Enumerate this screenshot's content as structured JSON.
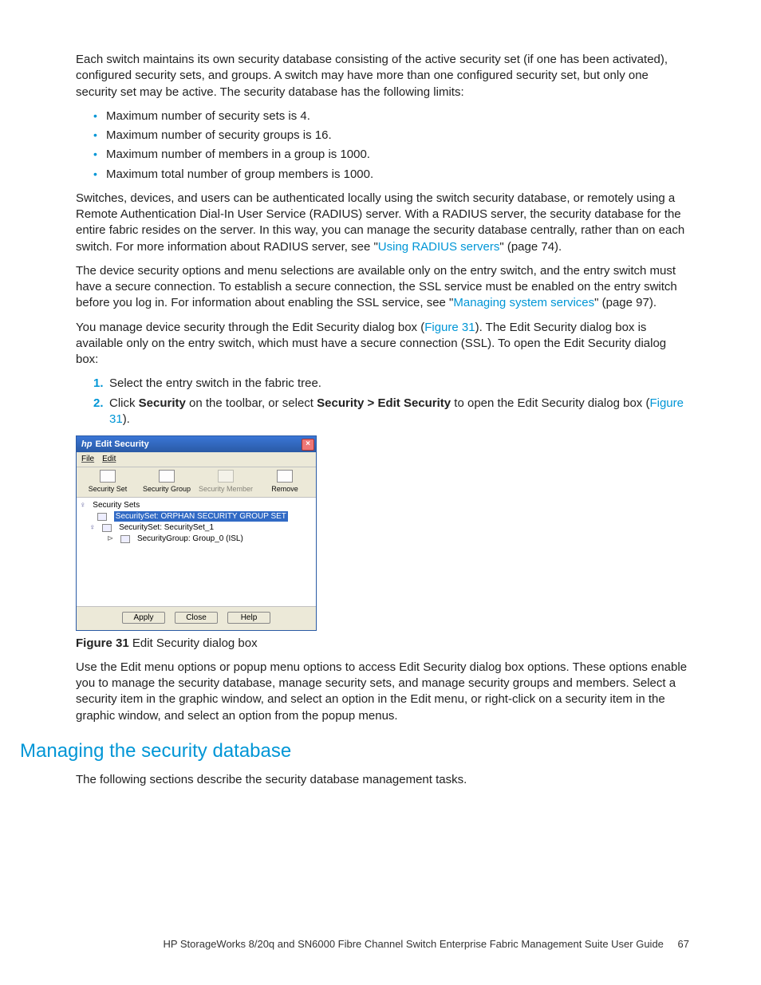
{
  "intro": "Each switch maintains its own security database consisting of the active security set (if one has been activated), configured security sets, and groups. A switch may have more than one configured security set, but only one security set may be active. The security database has the following limits:",
  "limits": [
    "Maximum number of security sets is 4.",
    "Maximum number of security groups is 16.",
    "Maximum number of members in a group is 1000.",
    "Maximum total number of group members is 1000."
  ],
  "p2_a": "Switches, devices, and users can be authenticated locally using the switch security database, or remotely using a Remote Authentication Dial-In User Service (RADIUS) server. With a RADIUS server, the security database for the entire fabric resides on the server. In this way, you can manage the security database centrally, rather than on each switch. For more information about RADIUS server, see \"",
  "p2_link": "Using RADIUS servers",
  "p2_b": "\" (page 74).",
  "p3_a": "The device security options and menu selections are available only on the entry switch, and the entry switch must have a secure connection. To establish a secure connection, the SSL service must be enabled on the entry switch before you log in. For information about enabling the SSL service, see \"",
  "p3_link": "Managing system services",
  "p3_b": "\" (page 97).",
  "p4_a": "You manage device security through the Edit Security dialog box (",
  "p4_link": "Figure 31",
  "p4_b": "). The Edit Security dialog box is available only on the entry switch, which must have a secure connection (SSL). To open the Edit Security dialog box:",
  "ol": [
    "Select the entry switch in the fabric tree."
  ],
  "ol2_a": "Click ",
  "ol2_b1": "Security",
  "ol2_c": " on the toolbar, or select ",
  "ol2_b2": "Security > Edit Security",
  "ol2_d": " to open the Edit Security dialog box (",
  "ol2_link": "Figure 31",
  "ol2_e": ").",
  "dialog": {
    "title": "Edit Security",
    "menu": {
      "file": "File",
      "edit": "Edit"
    },
    "toolbar": {
      "set": "Security Set",
      "group": "Security Group",
      "member": "Security Member",
      "remove": "Remove"
    },
    "tree": {
      "root": "Security Sets",
      "n1": "SecuritySet: ORPHAN SECURITY GROUP SET",
      "n2": "SecuritySet: SecuritySet_1",
      "n3": "SecurityGroup: Group_0 (ISL)"
    },
    "buttons": {
      "apply": "Apply",
      "close": "Close",
      "help": "Help"
    }
  },
  "figure_caption_bold": "Figure 31",
  "figure_caption_rest": "  Edit Security dialog box",
  "after_fig": "Use the Edit menu options or popup menu options to access Edit Security dialog box options. These options enable you to manage the security database, manage security sets, and manage security groups and members. Select a security item in the graphic window, and select an option in the Edit menu, or right-click on a security item in the graphic window, and select an option from the popup menus.",
  "h2": "Managing the security database",
  "h2_body": "The following sections describe the security database management tasks.",
  "footer_text": "HP StorageWorks 8/20q and SN6000 Fibre Channel Switch Enterprise Fabric Management Suite User Guide",
  "footer_page": "67"
}
